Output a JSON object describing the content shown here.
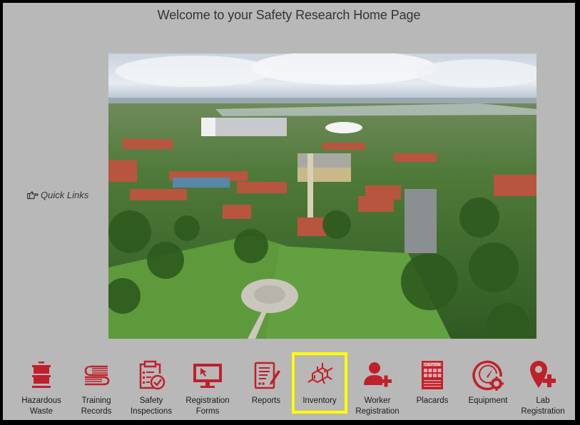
{
  "page": {
    "title": "Welcome to your Safety Research Home Page",
    "quick_links_label": "Quick Links",
    "quick_links_icon": "hand-pointer-icon",
    "hero_image_alt": "Aerial view of campus"
  },
  "colors": {
    "background": "#b8b8b8",
    "frame": "#000000",
    "icon_red": "#c0202a",
    "selected_outline": "#ffff00",
    "text": "#1a1a1a"
  },
  "quick_links": [
    {
      "label_line1": "Hazardous",
      "label_line2": "Waste",
      "icon": "waste-barrel-icon",
      "selected": false
    },
    {
      "label_line1": "Training",
      "label_line2": "Records",
      "icon": "books-icon",
      "selected": false
    },
    {
      "label_line1": "Safety",
      "label_line2": "Inspections",
      "icon": "clipboard-check-icon",
      "selected": false
    },
    {
      "label_line1": "Registration",
      "label_line2": "Forms",
      "icon": "monitor-cursor-icon",
      "selected": false
    },
    {
      "label_line1": "Reports",
      "label_line2": "",
      "icon": "report-pen-icon",
      "selected": false
    },
    {
      "label_line1": "Inventory",
      "label_line2": "",
      "icon": "molecule-icon",
      "selected": true
    },
    {
      "label_line1": "Worker",
      "label_line2": "Registration",
      "icon": "user-plus-icon",
      "selected": false
    },
    {
      "label_line1": "Placards",
      "label_line2": "",
      "icon": "caution-placard-icon",
      "selected": false
    },
    {
      "label_line1": "Equipment",
      "label_line2": "",
      "icon": "gauge-gear-icon",
      "selected": false
    },
    {
      "label_line1": "Lab",
      "label_line2": "Registration",
      "icon": "location-plus-icon",
      "selected": false
    }
  ],
  "placard_text": "CAUTION"
}
